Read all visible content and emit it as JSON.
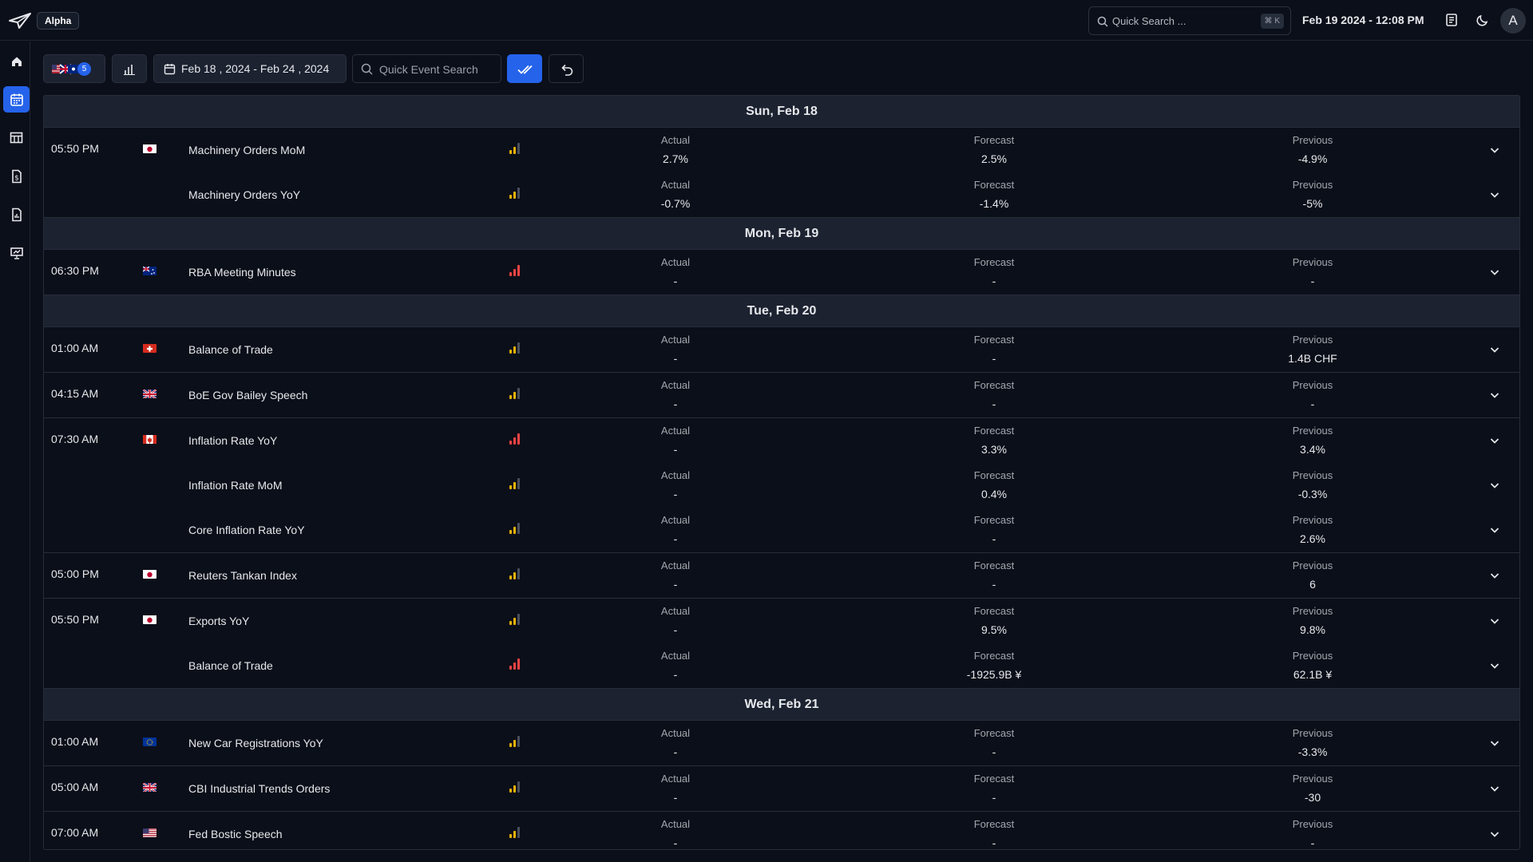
{
  "app": {
    "badge": "Alpha"
  },
  "topbar": {
    "search_placeholder": "Quick Search ...",
    "search_shortcut": "⌘ K",
    "datetime": "Feb 19 2024 - 12:08 PM",
    "avatar_initial": "A"
  },
  "toolbar": {
    "flag_count": "5",
    "date_range": "Feb 18 , 2024 - Feb 24 , 2024",
    "event_search_placeholder": "Quick Event Search"
  },
  "colors": {
    "accent": "#2563eb",
    "impact_medium": "#eab308",
    "impact_high": "#ef4444",
    "impact_dim": "#4a505c"
  },
  "labels": {
    "actual": "Actual",
    "forecast": "Forecast",
    "previous": "Previous"
  },
  "days": [
    {
      "label": "Sun, Feb 18",
      "groups": [
        {
          "time": "05:50 PM",
          "flag": "jp",
          "events": [
            {
              "name": "Machinery Orders MoM",
              "impact": "medium",
              "actual": "2.7%",
              "forecast": "2.5%",
              "previous": "-4.9%"
            },
            {
              "name": "Machinery Orders YoY",
              "impact": "medium",
              "actual": "-0.7%",
              "forecast": "-1.4%",
              "previous": "-5%"
            }
          ]
        }
      ]
    },
    {
      "label": "Mon, Feb 19",
      "groups": [
        {
          "time": "06:30 PM",
          "flag": "au",
          "events": [
            {
              "name": "RBA Meeting Minutes",
              "impact": "high",
              "actual": "-",
              "forecast": "-",
              "previous": "-"
            }
          ]
        }
      ]
    },
    {
      "label": "Tue, Feb 20",
      "groups": [
        {
          "time": "01:00 AM",
          "flag": "ch",
          "events": [
            {
              "name": "Balance of Trade",
              "impact": "medium",
              "actual": "-",
              "forecast": "-",
              "previous": "1.4B CHF"
            }
          ]
        },
        {
          "time": "04:15 AM",
          "flag": "gb",
          "events": [
            {
              "name": "BoE Gov Bailey Speech",
              "impact": "medium",
              "actual": "-",
              "forecast": "-",
              "previous": "-"
            }
          ]
        },
        {
          "time": "07:30 AM",
          "flag": "ca",
          "events": [
            {
              "name": "Inflation Rate YoY",
              "impact": "high",
              "actual": "-",
              "forecast": "3.3%",
              "previous": "3.4%"
            },
            {
              "name": "Inflation Rate MoM",
              "impact": "medium",
              "actual": "-",
              "forecast": "0.4%",
              "previous": "-0.3%"
            },
            {
              "name": "Core Inflation Rate YoY",
              "impact": "medium",
              "actual": "-",
              "forecast": "-",
              "previous": "2.6%"
            }
          ]
        },
        {
          "time": "05:00 PM",
          "flag": "jp",
          "events": [
            {
              "name": "Reuters Tankan Index",
              "impact": "medium",
              "actual": "-",
              "forecast": "-",
              "previous": "6"
            }
          ]
        },
        {
          "time": "05:50 PM",
          "flag": "jp",
          "events": [
            {
              "name": "Exports YoY",
              "impact": "medium",
              "actual": "-",
              "forecast": "9.5%",
              "previous": "9.8%"
            },
            {
              "name": "Balance of Trade",
              "impact": "high",
              "actual": "-",
              "forecast": "-1925.9B ¥",
              "previous": "62.1B ¥"
            }
          ]
        }
      ]
    },
    {
      "label": "Wed, Feb 21",
      "groups": [
        {
          "time": "01:00 AM",
          "flag": "eu",
          "events": [
            {
              "name": "New Car Registrations YoY",
              "impact": "medium",
              "actual": "-",
              "forecast": "-",
              "previous": "-3.3%"
            }
          ]
        },
        {
          "time": "05:00 AM",
          "flag": "gb",
          "events": [
            {
              "name": "CBI Industrial Trends Orders",
              "impact": "medium",
              "actual": "-",
              "forecast": "-",
              "previous": "-30"
            }
          ]
        },
        {
          "time": "07:00 AM",
          "flag": "us",
          "events": [
            {
              "name": "Fed Bostic Speech",
              "impact": "medium",
              "actual": "-",
              "forecast": "-",
              "previous": "-"
            }
          ]
        }
      ]
    }
  ]
}
